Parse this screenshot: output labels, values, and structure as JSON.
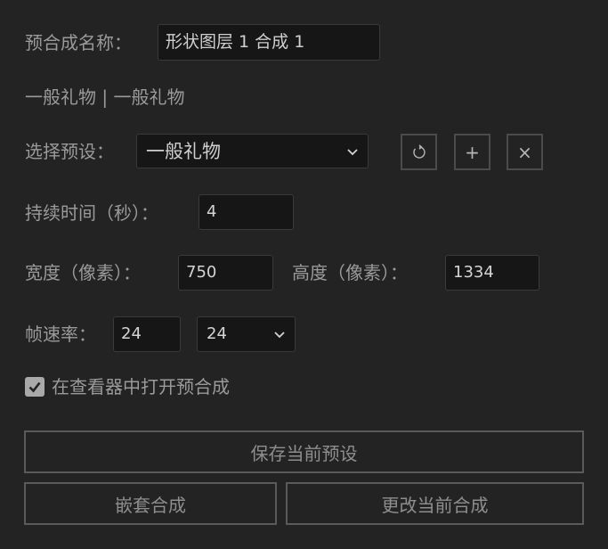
{
  "comp_name": {
    "label": "预合成名称：",
    "value": "形状图层 1 合成 1"
  },
  "preset_header": "一般礼物 | 一般礼物",
  "preset": {
    "label": "选择预设：",
    "selected": "一般礼物",
    "reset_icon": "refresh-icon",
    "add_glyph": "+",
    "delete_glyph": "×"
  },
  "duration": {
    "label": "持续时间（秒）：",
    "value": "4"
  },
  "width": {
    "label": "宽度（像素）：",
    "value": "750"
  },
  "height": {
    "label": "高度（像素）：",
    "value": "1334"
  },
  "framerate": {
    "label": "帧速率：",
    "value": "24",
    "selected": "24"
  },
  "open_in_viewer": {
    "label": "在查看器中打开预合成",
    "checked": true
  },
  "buttons": {
    "save_preset": "保存当前预设",
    "nest": "嵌套合成",
    "change_current": "更改当前合成"
  },
  "colors": {
    "background": "#232323",
    "field_bg": "#161616",
    "text": "#9a9a9a",
    "value_text": "#d4d4d4"
  }
}
